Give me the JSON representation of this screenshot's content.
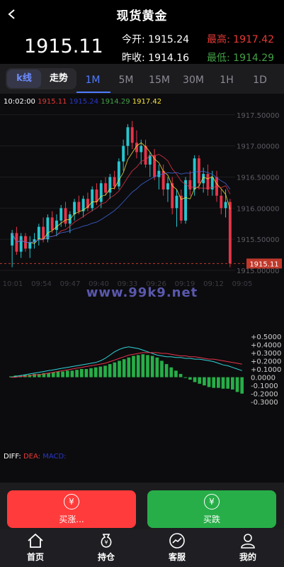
{
  "header": {
    "title": "现货黄金",
    "price": "1915.11",
    "open_label": "今开:",
    "open_value": "1915.24",
    "high_label": "最高:",
    "high_value": "1917.42",
    "prev_close_label": "昨收:",
    "prev_close_value": "1914.16",
    "low_label": "最低:",
    "low_value": "1914.29"
  },
  "tabs": {
    "kline": "k线",
    "trend": "走势",
    "intervals": [
      "1M",
      "5M",
      "15M",
      "30M",
      "1H",
      "1D"
    ],
    "active": "1M"
  },
  "legend": {
    "time": "10:02:00",
    "v1": "1915.11",
    "v2": "1915.24",
    "v3": "1914.29",
    "v4": "1917.42"
  },
  "watermark": "www.99k9.net",
  "macd_legend": {
    "diff": "DIFF:",
    "dea": "DEA:",
    "macd": "MACD:"
  },
  "buttons": {
    "buy_up_icon": "¥",
    "buy_up": "买涨...",
    "buy_down_icon": "¥",
    "buy_down": "买跌"
  },
  "nav": {
    "home": "首页",
    "positions": "持仓",
    "service": "客服",
    "mine": "我的"
  },
  "colors": {
    "up": "#e8344a",
    "down": "#26c6d0",
    "high": "#e53935",
    "low": "#43a047",
    "accent": "#4f7bff",
    "buy": "#ff3b3b",
    "sell": "#27ae48"
  },
  "chart_data": [
    {
      "type": "candlestick",
      "title": "",
      "x_ticks": [
        "10:01",
        "09:54",
        "09:47",
        "09:40",
        "09:33",
        "09:26",
        "09:19",
        "09:12",
        "09:05"
      ],
      "y_ticks": [
        "1917.50000",
        "1917.00000",
        "1916.50000",
        "1916.00000",
        "1915.50000",
        "1915.00000"
      ],
      "ylim": [
        1915.0,
        1917.6
      ],
      "current_price_label": "1915.11",
      "candles": [
        [
          1915.4,
          1915.65,
          1915.05,
          1915.6
        ],
        [
          1915.6,
          1915.7,
          1915.25,
          1915.3
        ],
        [
          1915.3,
          1915.6,
          1915.2,
          1915.55
        ],
        [
          1915.55,
          1915.6,
          1915.3,
          1915.35
        ],
        [
          1915.35,
          1915.55,
          1915.2,
          1915.45
        ],
        [
          1915.45,
          1915.6,
          1915.35,
          1915.5
        ],
        [
          1915.5,
          1915.75,
          1915.4,
          1915.7
        ],
        [
          1915.7,
          1915.85,
          1915.45,
          1915.5
        ],
        [
          1915.5,
          1915.9,
          1915.45,
          1915.85
        ],
        [
          1915.85,
          1915.95,
          1915.6,
          1915.65
        ],
        [
          1915.65,
          1915.9,
          1915.55,
          1915.8
        ],
        [
          1915.8,
          1916.05,
          1915.7,
          1916.0
        ],
        [
          1916.0,
          1916.1,
          1915.7,
          1915.75
        ],
        [
          1915.75,
          1915.95,
          1915.6,
          1915.9
        ],
        [
          1915.9,
          1916.15,
          1915.8,
          1916.1
        ],
        [
          1916.1,
          1916.2,
          1915.9,
          1915.95
        ],
        [
          1915.95,
          1916.2,
          1915.85,
          1916.15
        ],
        [
          1916.15,
          1916.25,
          1915.95,
          1916.0
        ],
        [
          1916.0,
          1916.35,
          1915.95,
          1916.3
        ],
        [
          1916.3,
          1916.4,
          1916.05,
          1916.1
        ],
        [
          1916.1,
          1916.45,
          1916.0,
          1916.4
        ],
        [
          1916.4,
          1916.5,
          1916.2,
          1916.25
        ],
        [
          1916.25,
          1916.55,
          1916.15,
          1916.5
        ],
        [
          1916.5,
          1916.6,
          1916.3,
          1916.35
        ],
        [
          1916.35,
          1916.8,
          1916.3,
          1916.75
        ],
        [
          1916.75,
          1917.1,
          1916.6,
          1917.0
        ],
        [
          1917.0,
          1917.35,
          1916.85,
          1917.3
        ],
        [
          1917.3,
          1917.4,
          1916.95,
          1917.05
        ],
        [
          1917.05,
          1917.25,
          1916.8,
          1916.9
        ],
        [
          1916.9,
          1917.1,
          1916.7,
          1917.0
        ],
        [
          1917.0,
          1917.1,
          1916.65,
          1916.7
        ],
        [
          1916.7,
          1916.9,
          1916.5,
          1916.85
        ],
        [
          1916.85,
          1916.95,
          1916.45,
          1916.5
        ],
        [
          1916.5,
          1916.7,
          1916.3,
          1916.6
        ],
        [
          1916.6,
          1916.7,
          1916.2,
          1916.3
        ],
        [
          1916.3,
          1916.5,
          1916.1,
          1916.4
        ],
        [
          1916.4,
          1916.5,
          1915.9,
          1916.0
        ],
        [
          1916.0,
          1916.3,
          1915.7,
          1916.2
        ],
        [
          1916.2,
          1916.3,
          1915.75,
          1915.8
        ],
        [
          1915.8,
          1916.5,
          1915.75,
          1916.45
        ],
        [
          1916.45,
          1916.6,
          1916.2,
          1916.3
        ],
        [
          1916.3,
          1916.85,
          1916.2,
          1916.8
        ],
        [
          1916.8,
          1916.85,
          1916.3,
          1916.4
        ],
        [
          1916.4,
          1916.65,
          1916.25,
          1916.55
        ],
        [
          1916.55,
          1916.7,
          1916.2,
          1916.3
        ],
        [
          1916.3,
          1916.6,
          1916.2,
          1916.5
        ],
        [
          1916.5,
          1916.6,
          1916.1,
          1916.2
        ],
        [
          1916.2,
          1916.3,
          1915.9,
          1916.0
        ],
        [
          1916.0,
          1916.3,
          1915.85,
          1916.1
        ],
        [
          1916.1,
          1916.15,
          1915.05,
          1915.11
        ]
      ]
    },
    {
      "type": "bar",
      "title": "MACD",
      "y_ticks": [
        "+0.5000",
        "+0.4000",
        "+0.3000",
        "+0.2000",
        "+0.1000",
        "0.0000",
        "-0.1000",
        "-0.2000",
        "-0.3000"
      ],
      "ylim": [
        -0.35,
        0.55
      ],
      "series": [
        {
          "name": "MACD",
          "values": [
            0.01,
            0.02,
            0.02,
            0.03,
            0.03,
            0.04,
            0.04,
            0.05,
            0.05,
            0.06,
            0.07,
            0.07,
            0.08,
            0.08,
            0.09,
            0.1,
            0.1,
            0.11,
            0.12,
            0.13,
            0.14,
            0.16,
            0.18,
            0.2,
            0.22,
            0.24,
            0.26,
            0.27,
            0.28,
            0.27,
            0.26,
            0.24,
            0.2,
            0.16,
            0.12,
            0.08,
            0.04,
            0.0,
            -0.03,
            -0.06,
            -0.08,
            -0.1,
            -0.12,
            -0.13,
            -0.13,
            -0.14,
            -0.14,
            -0.15,
            -0.18,
            -0.2
          ]
        },
        {
          "name": "DIFF",
          "values": [
            0.0,
            0.01,
            0.02,
            0.03,
            0.04,
            0.05,
            0.06,
            0.07,
            0.08,
            0.09,
            0.1,
            0.11,
            0.12,
            0.13,
            0.14,
            0.15,
            0.16,
            0.17,
            0.18,
            0.2,
            0.23,
            0.27,
            0.31,
            0.34,
            0.36,
            0.37,
            0.36,
            0.35,
            0.33,
            0.31,
            0.29,
            0.27,
            0.26,
            0.25,
            0.25,
            0.24,
            0.24,
            0.23,
            0.23,
            0.22,
            0.22,
            0.21,
            0.2,
            0.19,
            0.17,
            0.15,
            0.14,
            0.12,
            0.1,
            0.08
          ]
        },
        {
          "name": "DEA",
          "values": [
            0.0,
            0.0,
            0.01,
            0.01,
            0.02,
            0.03,
            0.03,
            0.04,
            0.05,
            0.06,
            0.07,
            0.08,
            0.09,
            0.1,
            0.11,
            0.12,
            0.13,
            0.14,
            0.15,
            0.16,
            0.17,
            0.19,
            0.21,
            0.23,
            0.25,
            0.27,
            0.28,
            0.29,
            0.3,
            0.3,
            0.3,
            0.3,
            0.29,
            0.29,
            0.28,
            0.27,
            0.26,
            0.26,
            0.25,
            0.25,
            0.24,
            0.23,
            0.22,
            0.22,
            0.21,
            0.2,
            0.19,
            0.18,
            0.17,
            0.16
          ]
        }
      ]
    }
  ]
}
